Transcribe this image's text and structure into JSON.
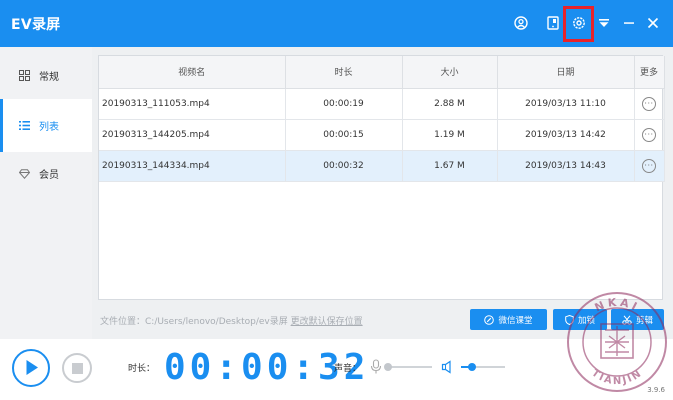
{
  "app": {
    "title": "EV录屏",
    "version": "3.9.6"
  },
  "colors": {
    "accent": "#1a8ef0",
    "highlight_border": "#e8232b",
    "selected_row": "#e3f0fc"
  },
  "titlebar": {
    "icons": [
      "user-icon",
      "phone-icon",
      "gear-icon",
      "dropdown-icon",
      "minimize-icon",
      "close-icon"
    ]
  },
  "sidebar": {
    "items": [
      {
        "label": "常规",
        "icon": "grid-icon",
        "active": false
      },
      {
        "label": "列表",
        "icon": "list-icon",
        "active": true
      },
      {
        "label": "会员",
        "icon": "diamond-icon",
        "active": false
      }
    ]
  },
  "table": {
    "headers": [
      "视频名",
      "时长",
      "大小",
      "日期",
      "更多"
    ],
    "rows": [
      {
        "name": "20190313_111053.mp4",
        "duration": "00:00:19",
        "size": "2.88 M",
        "date": "2019/03/13 11:10",
        "more": "···"
      },
      {
        "name": "20190313_144205.mp4",
        "duration": "00:00:15",
        "size": "1.19 M",
        "date": "2019/03/13 14:42",
        "more": "···"
      },
      {
        "name": "20190313_144334.mp4",
        "duration": "00:00:32",
        "size": "1.67 M",
        "date": "2019/03/13 14:43",
        "more": "···",
        "selected": true
      }
    ]
  },
  "footer": {
    "path_label": "文件位置：C:/Users/lenovo/Desktop/ev录屏",
    "change_path": "更改默认保存位置",
    "buttons": {
      "wechat": "微信课堂",
      "watermark": "加锁",
      "edit": "剪辑"
    }
  },
  "bottom": {
    "duration_label": "时长：",
    "timer": "00:00:32",
    "sound_label": "声音：",
    "mic_level": 0,
    "speaker_level": 0.25
  },
  "watermark": {
    "top_text": "NKAI",
    "bottom_text": "TIANJIN"
  }
}
